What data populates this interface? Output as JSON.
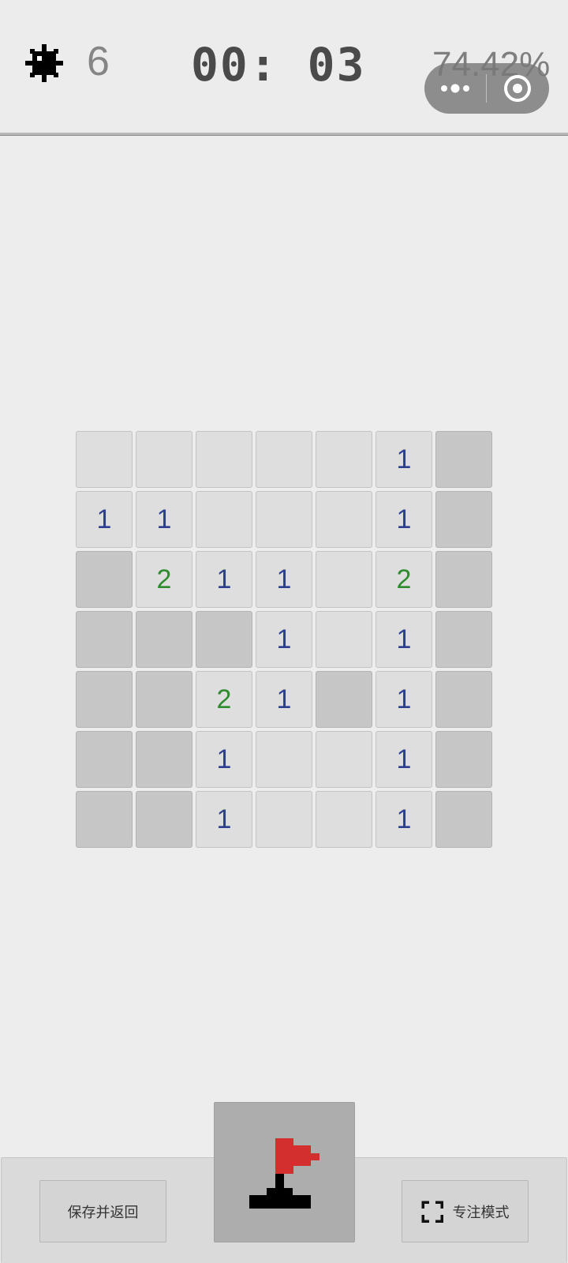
{
  "header": {
    "mine_count": "6",
    "timer": "00: 03",
    "progress": "74.42%"
  },
  "board": {
    "rows": 7,
    "cols": 7,
    "cells": [
      [
        "",
        "",
        "",
        "",
        "",
        "1",
        "#"
      ],
      [
        "1",
        "1",
        "",
        "",
        "",
        "1",
        "#"
      ],
      [
        "#",
        "2",
        "1",
        "1",
        "",
        "2",
        "#"
      ],
      [
        "#",
        "#",
        "#",
        "1",
        "",
        "1",
        "#"
      ],
      [
        "#",
        "#",
        "2",
        "1",
        "#",
        "1",
        "#"
      ],
      [
        "#",
        "#",
        "1",
        "",
        "",
        "1",
        "#"
      ],
      [
        "#",
        "#",
        "1",
        "",
        "",
        "1",
        "#"
      ]
    ]
  },
  "footer": {
    "save_label": "保存并返回",
    "focus_label": "专注模式"
  },
  "colors": {
    "number_1": "#2c3e91",
    "number_2": "#2e8b2e",
    "flag_red": "#d32f2f"
  },
  "icons": {
    "mine": "mine-icon",
    "flag": "flag-icon",
    "focus": "fullscreen-icon",
    "more": "more-dots-icon",
    "close": "target-circle-icon"
  }
}
